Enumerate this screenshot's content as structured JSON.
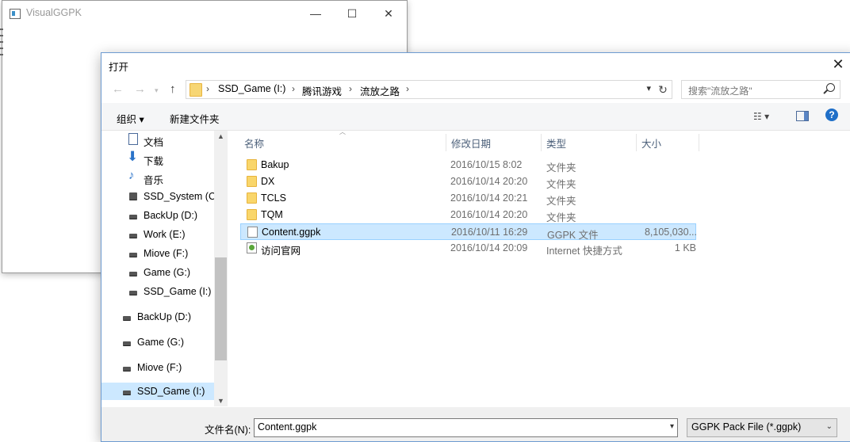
{
  "bg_window": {
    "title": "VisualGGPK",
    "minimize": "—",
    "maximize": "☐",
    "close": "✕"
  },
  "dialog": {
    "title": "打开",
    "close": "✕"
  },
  "address": {
    "crumbs": [
      "SSD_Game (I:)",
      "腾讯游戏",
      "流放之路"
    ],
    "search_placeholder": "搜索\"流放之路\""
  },
  "toolbar": {
    "organize": "组织 ▾",
    "new_folder": "新建文件夹",
    "help": "?"
  },
  "tree": [
    {
      "label": "文档",
      "icon": "document-icon"
    },
    {
      "label": "下载",
      "icon": "download-icon"
    },
    {
      "label": "音乐",
      "icon": "music-icon"
    },
    {
      "label": "SSD_System (C:",
      "icon": "system-drive-icon"
    },
    {
      "label": "BackUp (D:)",
      "icon": "drive-icon"
    },
    {
      "label": "Work (E:)",
      "icon": "drive-icon"
    },
    {
      "label": "Miove (F:)",
      "icon": "drive-icon"
    },
    {
      "label": "Game (G:)",
      "icon": "drive-icon"
    },
    {
      "label": "SSD_Game (I:)",
      "icon": "drive-icon"
    },
    {
      "label": "BackUp (D:)",
      "icon": "drive-icon"
    },
    {
      "label": "Game (G:)",
      "icon": "drive-icon"
    },
    {
      "label": "Miove (F:)",
      "icon": "drive-icon"
    },
    {
      "label": "SSD_Game (I:)",
      "icon": "drive-icon",
      "selected": true
    }
  ],
  "list": {
    "columns": [
      "名称",
      "修改日期",
      "类型",
      "大小"
    ],
    "rows": [
      {
        "name": "Bakup",
        "date": "2016/10/15 8:02",
        "type": "文件夹",
        "size": "",
        "icon": "folder-icon"
      },
      {
        "name": "DX",
        "date": "2016/10/14 20:20",
        "type": "文件夹",
        "size": "",
        "icon": "folder-icon"
      },
      {
        "name": "TCLS",
        "date": "2016/10/14 20:21",
        "type": "文件夹",
        "size": "",
        "icon": "folder-icon"
      },
      {
        "name": "TQM",
        "date": "2016/10/14 20:20",
        "type": "文件夹",
        "size": "",
        "icon": "folder-icon"
      },
      {
        "name": "Content.ggpk",
        "date": "2016/10/11 16:29",
        "type": "GGPK 文件",
        "size": "8,105,030...",
        "icon": "file-icon",
        "selected": true
      },
      {
        "name": "访问官网",
        "date": "2016/10/14 20:09",
        "type": "Internet 快捷方式",
        "size": "1 KB",
        "icon": "internet-shortcut-icon"
      }
    ]
  },
  "bottom": {
    "filename_label": "文件名(N):",
    "filename_value": "Content.ggpk",
    "filetype_value": "GGPK Pack File (*.ggpk)"
  }
}
